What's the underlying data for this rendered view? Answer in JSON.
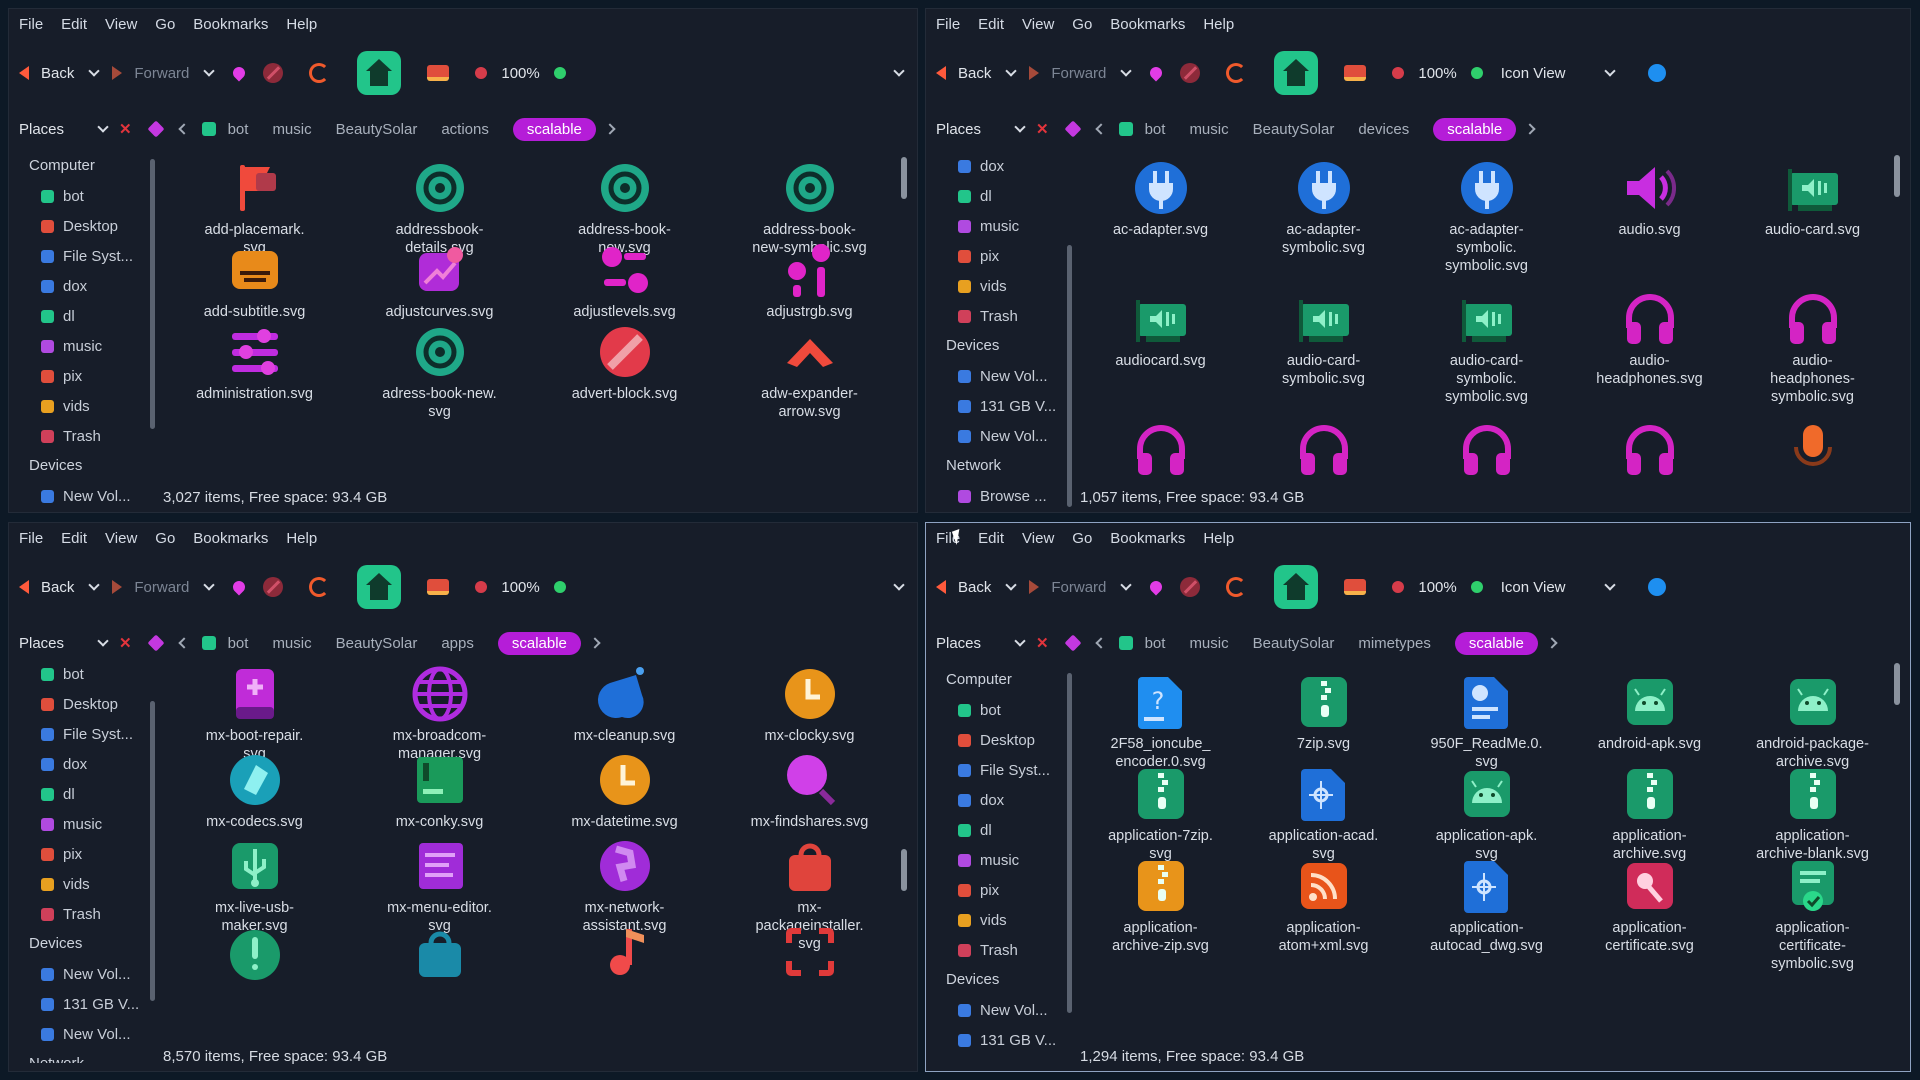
{
  "menu": [
    "File",
    "Edit",
    "View",
    "Go",
    "Bookmarks",
    "Help"
  ],
  "toolbar": {
    "back": "Back",
    "forward": "Forward",
    "zoom": "100%",
    "view_mode": "Icon View"
  },
  "places_label": "Places",
  "windows": [
    {
      "crumbs": [
        "bot",
        "music",
        "BeautySolar",
        "actions",
        "scalable"
      ],
      "sidebar": [
        {
          "type": "head",
          "label": "Computer"
        },
        {
          "type": "item",
          "label": "bot",
          "color": "#22c58a"
        },
        {
          "type": "item",
          "label": "Desktop",
          "color": "#e04e3c"
        },
        {
          "type": "item",
          "label": "File Syst...",
          "color": "#3a7ae0"
        },
        {
          "type": "item",
          "label": "dox",
          "color": "#3a7ae0"
        },
        {
          "type": "item",
          "label": "dl",
          "color": "#22c58a"
        },
        {
          "type": "item",
          "label": "music",
          "color": "#b04ae0"
        },
        {
          "type": "item",
          "label": "pix",
          "color": "#e04e3c"
        },
        {
          "type": "item",
          "label": "vids",
          "color": "#e8a020"
        },
        {
          "type": "item",
          "label": "Trash",
          "color": "#d0405a"
        },
        {
          "type": "head",
          "label": "Devices"
        },
        {
          "type": "item",
          "label": "New Vol...",
          "color": "#3a7ae0"
        }
      ],
      "files": [
        {
          "name": "add-placemark.\nsvg",
          "icon": "flag-icon",
          "color": "#f04a3c"
        },
        {
          "name": "addressbook-\ndetails.svg",
          "icon": "at-icon",
          "color": "#1fa888"
        },
        {
          "name": "address-book-\nnew.svg",
          "icon": "at-icon",
          "color": "#1fa888"
        },
        {
          "name": "address-book-\nnew-symbolic.svg",
          "icon": "at-icon",
          "color": "#1fa888"
        },
        {
          "name": "add-subtitle.svg",
          "icon": "subtitle-icon",
          "color": "#e88a1a"
        },
        {
          "name": "adjustcurves.svg",
          "icon": "curves-icon",
          "color": "#b02cd8"
        },
        {
          "name": "adjustlevels.svg",
          "icon": "levels-icon",
          "color": "#e024c8"
        },
        {
          "name": "adjustrgb.svg",
          "icon": "rgb-icon",
          "color": "#e024c8"
        },
        {
          "name": "administration.svg",
          "icon": "sliders-icon",
          "color": "#c02ce0"
        },
        {
          "name": "adress-book-new.\nsvg",
          "icon": "at-icon",
          "color": "#1fa888"
        },
        {
          "name": "advert-block.svg",
          "icon": "block-icon",
          "color": "#e23a4a"
        },
        {
          "name": "adw-expander-\narrow.svg",
          "icon": "chevron-up-icon",
          "color": "#f04a3c"
        }
      ],
      "status": "3,027 items, Free space: 93.4 GB"
    },
    {
      "crumbs": [
        "bot",
        "music",
        "BeautySolar",
        "devices",
        "scalable"
      ],
      "sidebar": [
        {
          "type": "item",
          "label": "dox",
          "color": "#3a7ae0"
        },
        {
          "type": "item",
          "label": "dl",
          "color": "#22c58a"
        },
        {
          "type": "item",
          "label": "music",
          "color": "#b04ae0"
        },
        {
          "type": "item",
          "label": "pix",
          "color": "#e04e3c"
        },
        {
          "type": "item",
          "label": "vids",
          "color": "#e8a020"
        },
        {
          "type": "item",
          "label": "Trash",
          "color": "#d0405a"
        },
        {
          "type": "head",
          "label": "Devices"
        },
        {
          "type": "item",
          "label": "New Vol...",
          "color": "#3a7ae0"
        },
        {
          "type": "item",
          "label": "131 GB V...",
          "color": "#3a7ae0"
        },
        {
          "type": "item",
          "label": "New Vol...",
          "color": "#3a7ae0"
        },
        {
          "type": "head",
          "label": "Network"
        },
        {
          "type": "item",
          "label": "Browse ...",
          "color": "#b04ae0"
        }
      ],
      "files": [
        {
          "name": "ac-adapter.svg",
          "icon": "plug-icon",
          "color": "#1f6fd8"
        },
        {
          "name": "ac-adapter-\nsymbolic.svg",
          "icon": "plug-icon",
          "color": "#1f6fd8"
        },
        {
          "name": "ac-adapter-\nsymbolic.\nsymbolic.svg",
          "icon": "plug-icon",
          "color": "#1f6fd8"
        },
        {
          "name": "audio.svg",
          "icon": "speaker-icon",
          "color": "#c82ee0"
        },
        {
          "name": "audio-card.svg",
          "icon": "audio-card-icon",
          "color": "#1a9a6a"
        },
        {
          "name": "audiocard.svg",
          "icon": "audio-card-icon",
          "color": "#1a9a6a"
        },
        {
          "name": "audio-card-\nsymbolic.svg",
          "icon": "audio-card-icon",
          "color": "#1a9a6a"
        },
        {
          "name": "audio-card-\nsymbolic.\nsymbolic.svg",
          "icon": "audio-card-icon",
          "color": "#1a9a6a"
        },
        {
          "name": "audio-\nheadphones.svg",
          "icon": "headphones-icon",
          "color": "#d424c4"
        },
        {
          "name": "audio-\nheadphones-\nsymbolic.svg",
          "icon": "headphones-icon",
          "color": "#d424c4"
        },
        {
          "name": "",
          "icon": "headphones-icon",
          "color": "#d424c4"
        },
        {
          "name": "",
          "icon": "headphones-icon",
          "color": "#d424c4"
        },
        {
          "name": "",
          "icon": "headphones-icon",
          "color": "#d424c4"
        },
        {
          "name": "",
          "icon": "headphones-icon",
          "color": "#d424c4"
        },
        {
          "name": "",
          "icon": "microphone-icon",
          "color": "#f06a2a"
        }
      ],
      "status": "1,057 items, Free space: 93.4 GB"
    },
    {
      "crumbs": [
        "bot",
        "music",
        "BeautySolar",
        "apps",
        "scalable"
      ],
      "sidebar": [
        {
          "type": "item",
          "label": "bot",
          "color": "#22c58a"
        },
        {
          "type": "item",
          "label": "Desktop",
          "color": "#e04e3c"
        },
        {
          "type": "item",
          "label": "File Syst...",
          "color": "#3a7ae0"
        },
        {
          "type": "item",
          "label": "dox",
          "color": "#3a7ae0"
        },
        {
          "type": "item",
          "label": "dl",
          "color": "#22c58a"
        },
        {
          "type": "item",
          "label": "music",
          "color": "#b04ae0"
        },
        {
          "type": "item",
          "label": "pix",
          "color": "#e04e3c"
        },
        {
          "type": "item",
          "label": "vids",
          "color": "#e8a020"
        },
        {
          "type": "item",
          "label": "Trash",
          "color": "#d0405a"
        },
        {
          "type": "head",
          "label": "Devices"
        },
        {
          "type": "item",
          "label": "New Vol...",
          "color": "#3a7ae0"
        },
        {
          "type": "item",
          "label": "131 GB V...",
          "color": "#3a7ae0"
        },
        {
          "type": "item",
          "label": "New Vol...",
          "color": "#3a7ae0"
        },
        {
          "type": "head",
          "label": "Network"
        }
      ],
      "files": [
        {
          "name": "mx-boot-repair.\nsvg",
          "icon": "boot-repair-icon",
          "color": "#c02cd8"
        },
        {
          "name": "mx-broadcom-\nmanager.svg",
          "icon": "globe-icon",
          "color": "#b02ce0"
        },
        {
          "name": "mx-cleanup.svg",
          "icon": "broom-icon",
          "color": "#1f6fd8"
        },
        {
          "name": "mx-clocky.svg",
          "icon": "clock-icon",
          "color": "#e8941a"
        },
        {
          "name": "mx-codecs.svg",
          "icon": "codecs-icon",
          "color": "#1aa0b8"
        },
        {
          "name": "mx-conky.svg",
          "icon": "terminal-icon",
          "color": "#1a9a5a"
        },
        {
          "name": "mx-datetime.svg",
          "icon": "clock-icon",
          "color": "#e8941a"
        },
        {
          "name": "mx-findshares.svg",
          "icon": "magnifier-icon",
          "color": "#d040e8"
        },
        {
          "name": "mx-live-usb-\nmaker.svg",
          "icon": "usb-icon",
          "color": "#1a9a6a"
        },
        {
          "name": "mx-menu-editor.\nsvg",
          "icon": "menu-editor-icon",
          "color": "#a02cd8"
        },
        {
          "name": "mx-network-\nassistant.svg",
          "icon": "network-globe-icon",
          "color": "#a02cd8"
        },
        {
          "name": "mx-\npackageinstaller.\nsvg",
          "icon": "package-icon",
          "color": "#e0443c"
        },
        {
          "name": "",
          "icon": "exclamation-icon",
          "color": "#1a9a6a"
        },
        {
          "name": "",
          "icon": "bag-icon",
          "color": "#1a8aa8"
        },
        {
          "name": "",
          "icon": "music-note-icon",
          "color": "#f04a4a"
        },
        {
          "name": "",
          "icon": "screenshot-icon",
          "color": "#e03a3a"
        }
      ],
      "status": "8,570 items, Free space: 93.4 GB"
    },
    {
      "crumbs": [
        "bot",
        "music",
        "BeautySolar",
        "mimetypes",
        "scalable"
      ],
      "sidebar": [
        {
          "type": "head",
          "label": "Computer"
        },
        {
          "type": "item",
          "label": "bot",
          "color": "#22c58a"
        },
        {
          "type": "item",
          "label": "Desktop",
          "color": "#e04e3c"
        },
        {
          "type": "item",
          "label": "File Syst...",
          "color": "#3a7ae0"
        },
        {
          "type": "item",
          "label": "dox",
          "color": "#3a7ae0"
        },
        {
          "type": "item",
          "label": "dl",
          "color": "#22c58a"
        },
        {
          "type": "item",
          "label": "music",
          "color": "#b04ae0"
        },
        {
          "type": "item",
          "label": "pix",
          "color": "#e04e3c"
        },
        {
          "type": "item",
          "label": "vids",
          "color": "#e8a020"
        },
        {
          "type": "item",
          "label": "Trash",
          "color": "#d0405a"
        },
        {
          "type": "head",
          "label": "Devices"
        },
        {
          "type": "item",
          "label": "New Vol...",
          "color": "#3a7ae0"
        },
        {
          "type": "item",
          "label": "131 GB V...",
          "color": "#3a7ae0"
        }
      ],
      "files": [
        {
          "name": "2F58_ioncube_\nencoder.0.svg",
          "icon": "question-doc-icon",
          "color": "#1f8ef0"
        },
        {
          "name": "7zip.svg",
          "icon": "zip-icon",
          "color": "#1a9a6a"
        },
        {
          "name": "950F_ReadMe.0.\nsvg",
          "icon": "info-doc-icon",
          "color": "#1f6fd8"
        },
        {
          "name": "android-apk.svg",
          "icon": "android-icon",
          "color": "#1a9a6a"
        },
        {
          "name": "android-package-\narchive.svg",
          "icon": "android-icon",
          "color": "#1a9a6a"
        },
        {
          "name": "application-7zip.\nsvg",
          "icon": "zip-icon",
          "color": "#1a9a6a"
        },
        {
          "name": "application-acad.\nsvg",
          "icon": "cad-icon",
          "color": "#1f6fd8"
        },
        {
          "name": "application-apk.\nsvg",
          "icon": "android-icon",
          "color": "#1a9a6a"
        },
        {
          "name": "application-\narchive.svg",
          "icon": "zip-icon",
          "color": "#1a9a6a"
        },
        {
          "name": "application-\narchive-blank.svg",
          "icon": "zip-icon",
          "color": "#1a9a6a"
        },
        {
          "name": "application-\narchive-zip.svg",
          "icon": "zip-icon",
          "color": "#e8941a"
        },
        {
          "name": "application-\natom+xml.svg",
          "icon": "rss-icon",
          "color": "#e8541a"
        },
        {
          "name": "application-\nautocad_dwg.svg",
          "icon": "cad-icon",
          "color": "#1f6fd8"
        },
        {
          "name": "application-\ncertificate.svg",
          "icon": "certificate-icon",
          "color": "#d02c5a"
        },
        {
          "name": "application-\ncertificate-\nsymbolic.svg",
          "icon": "certificate-check-icon",
          "color": "#1a9a6a"
        }
      ],
      "status": "1,294 items, Free space: 93.4 GB"
    }
  ]
}
